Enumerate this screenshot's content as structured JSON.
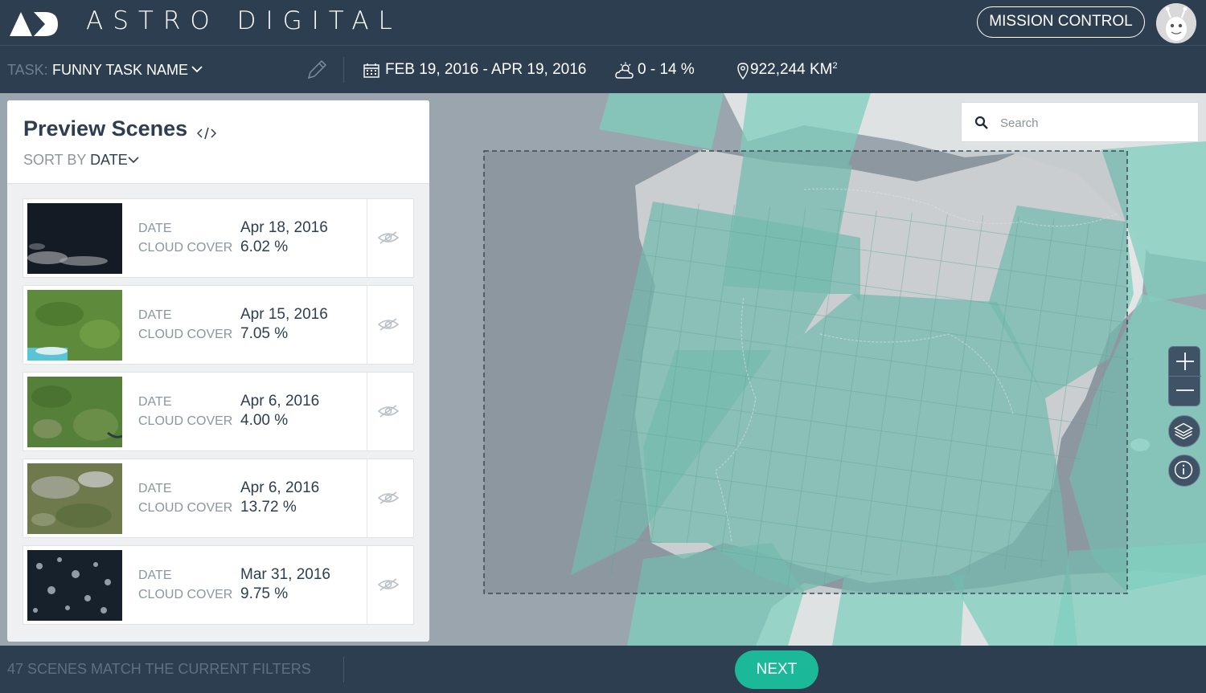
{
  "header": {
    "brand": "ASTRO DIGITAL",
    "logo_icon": "astro-digital-logo",
    "mission_control_label": "MISSION CONTROL",
    "avatar_icon": "alien-avatar"
  },
  "taskbar": {
    "task_label": "TASK:",
    "task_name": "FUNNY TASK NAME",
    "date_range": "FEB 19, 2016 - APR 19, 2016",
    "cloud_range": "0 - 14 %",
    "area_value": "922,244 KM",
    "area_unit_superscript": "2"
  },
  "map": {
    "search_placeholder": "Search",
    "colors": {
      "water": "#9aa5ad",
      "land": "#e3e5e6",
      "tile": "#7fcfbe",
      "selection_border": "#3b4a56"
    }
  },
  "panel": {
    "title": "Preview Scenes",
    "sort_prefix": "SORT BY",
    "sort_value": "DATE",
    "scenes": [
      {
        "date_label": "DATE",
        "cloud_label": "CLOUD COVER",
        "date": "Apr 18, 2016",
        "cloud": "6.02 %"
      },
      {
        "date_label": "DATE",
        "cloud_label": "CLOUD COVER",
        "date": "Apr 15, 2016",
        "cloud": "7.05 %"
      },
      {
        "date_label": "DATE",
        "cloud_label": "CLOUD COVER",
        "date": "Apr 6, 2016",
        "cloud": "4.00 %"
      },
      {
        "date_label": "DATE",
        "cloud_label": "CLOUD COVER",
        "date": "Apr 6, 2016",
        "cloud": "13.72 %"
      },
      {
        "date_label": "DATE",
        "cloud_label": "CLOUD COVER",
        "date": "Mar 31, 2016",
        "cloud": "9.75 %"
      }
    ]
  },
  "footer": {
    "match_text": "47 SCENES MATCH THE CURRENT FILTERS",
    "next_label": "NEXT"
  }
}
